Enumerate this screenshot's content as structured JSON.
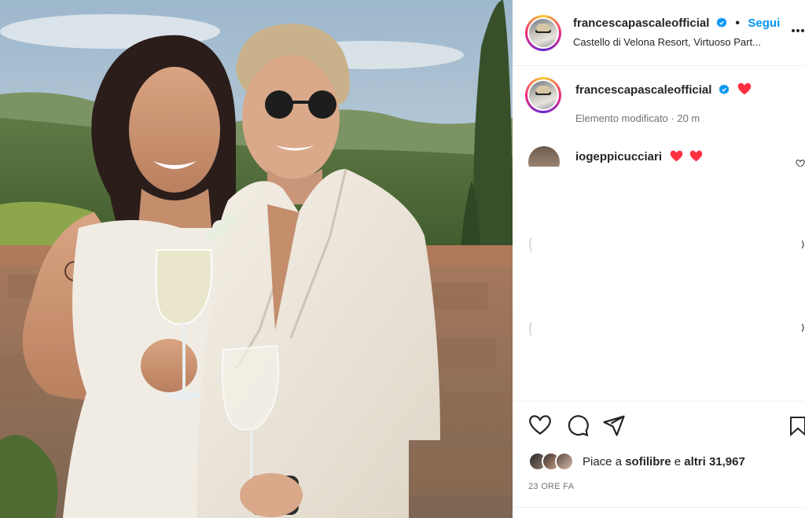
{
  "post": {
    "username": "francescapascaleofficial",
    "follow_label": "Segui",
    "location": "Castello di Velona Resort, Virtuoso Part...",
    "more_label": "⋮",
    "dot": "•"
  },
  "caption": {
    "username": "francescapascaleofficial",
    "meta": "Elemento modificato · 20 m"
  },
  "comment": {
    "username": "iogeppicucciari"
  },
  "likes": {
    "prefix": "Piace a",
    "user": "sofilibre",
    "conj": "e",
    "others": "altri 31,967"
  },
  "timestamp": "23 ORE FA",
  "colors": {
    "accent": "#0095f6",
    "heart": "#ff3040",
    "verified": "#0095f6",
    "muted": "#737373"
  },
  "icons": [
    "verified-icon",
    "heart-icon",
    "comment-icon",
    "share-icon",
    "save-icon",
    "more-icon"
  ]
}
